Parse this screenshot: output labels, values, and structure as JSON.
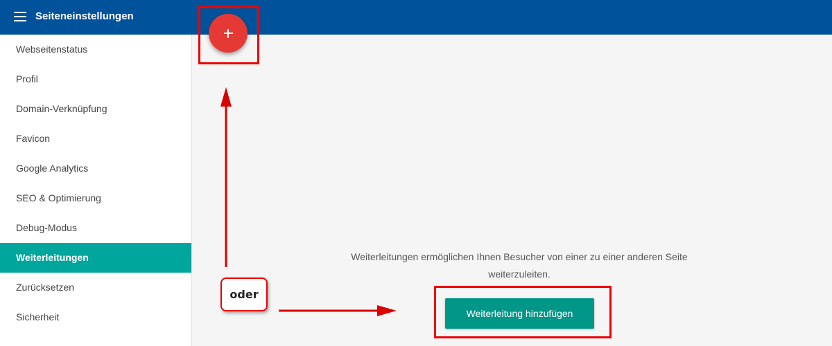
{
  "header": {
    "title": "Seiteneinstellungen",
    "menu_icon": "hamburger-menu-icon"
  },
  "sidebar": {
    "items": [
      {
        "label": "Webseitenstatus",
        "active": false
      },
      {
        "label": "Profil",
        "active": false
      },
      {
        "label": "Domain-Verknüpfung",
        "active": false
      },
      {
        "label": "Favicon",
        "active": false
      },
      {
        "label": "Google Analytics",
        "active": false
      },
      {
        "label": "SEO & Optimierung",
        "active": false
      },
      {
        "label": "Debug-Modus",
        "active": false
      },
      {
        "label": "Weiterleitungen",
        "active": true
      },
      {
        "label": "Zurücksetzen",
        "active": false
      },
      {
        "label": "Sicherheit",
        "active": false
      }
    ]
  },
  "main": {
    "fab_icon": "plus-icon",
    "info_line1": "Weiterleitungen ermöglichen Ihnen Besucher von einer zu einer anderen Seite",
    "info_line2": "weiterzuleiten.",
    "add_button_label": "Weiterleitung hinzufügen"
  },
  "annotation": {
    "or_label": "oder"
  },
  "colors": {
    "header": "#00529b",
    "active_item": "#00a59b",
    "fab": "#e53935",
    "button": "#009688",
    "annotation": "#e00000"
  }
}
